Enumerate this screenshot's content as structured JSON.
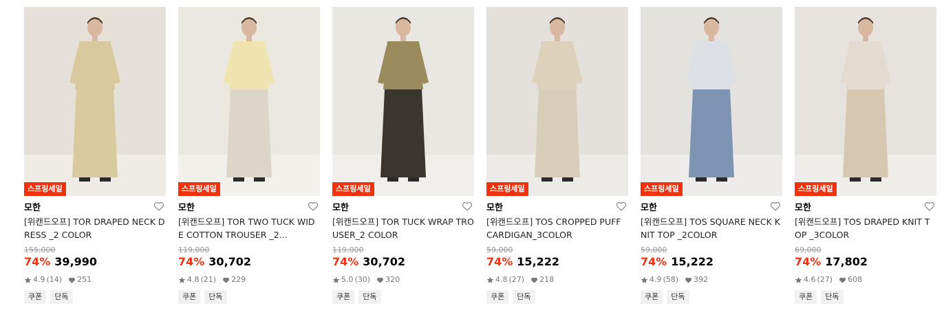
{
  "products": [
    {
      "badge": "스프링세일",
      "brand": "모한",
      "name": "[위캔드오프] TOR DRAPED NECK DRESS _2 COLOR",
      "original_price": "155,000",
      "discount": "74%",
      "price": "39,990",
      "rating": "4.9",
      "reviews": "(14)",
      "likes": "251",
      "tags": [
        "쿠폰",
        "단독"
      ],
      "outfit": {
        "top": "#d9c99e",
        "bottom": "#d9c99e",
        "bg": "#e6e1d8"
      }
    },
    {
      "badge": "스프링세일",
      "brand": "모한",
      "name": "[위캔드오프] TOR TWO TUCK WIDE COTTON TROUSER _2...",
      "original_price": "119,000",
      "discount": "74%",
      "price": "30,702",
      "rating": "4.8",
      "reviews": "(21)",
      "likes": "229",
      "tags": [
        "쿠폰",
        "단독"
      ],
      "outfit": {
        "top": "#efe3b0",
        "bottom": "#ddd6c8",
        "bg": "#ebe8e0"
      }
    },
    {
      "badge": "스프링세일",
      "brand": "모한",
      "name": "[위캔드오프] TOR TUCK WRAP TROUSER_2 COLOR",
      "original_price": "119,000",
      "discount": "74%",
      "price": "30,702",
      "rating": "5.0",
      "reviews": "(30)",
      "likes": "320",
      "tags": [
        "쿠폰",
        "단독"
      ],
      "outfit": {
        "top": "#9b8a5c",
        "bottom": "#3a352d",
        "bg": "#e9e7e2"
      }
    },
    {
      "badge": "스프링세일",
      "brand": "모한",
      "name": "[위캔드오프] TOS CROPPED PUFF CARDIGAN_3COLOR",
      "original_price": "59,000",
      "discount": "74%",
      "price": "15,222",
      "rating": "4.8",
      "reviews": "(27)",
      "likes": "218",
      "tags": [
        "쿠폰",
        "단독"
      ],
      "outfit": {
        "top": "#dfd2bd",
        "bottom": "#d8cdb9",
        "bg": "#e4e1dc"
      }
    },
    {
      "badge": "스프링세일",
      "brand": "모한",
      "name": "[위캔드오프] TOS SQUARE NECK KNIT TOP _2COLOR",
      "original_price": "59,000",
      "discount": "74%",
      "price": "15,222",
      "rating": "4.9",
      "reviews": "(58)",
      "likes": "392",
      "tags": [
        "쿠폰",
        "단독"
      ],
      "outfit": {
        "top": "#dde0e4",
        "bottom": "#7d95b3",
        "bg": "#e3e2df"
      }
    },
    {
      "badge": "스프링세일",
      "brand": "모한",
      "name": "[위캔드오프] TOS DRAPED KNIT TOP _3COLOR",
      "original_price": "69,000",
      "discount": "74%",
      "price": "17,802",
      "rating": "4.6",
      "reviews": "(27)",
      "likes": "608",
      "tags": [
        "쿠폰",
        "단독"
      ],
      "outfit": {
        "top": "#e3dbcf",
        "bottom": "#d6c8b0",
        "bg": "#e6e3de"
      }
    }
  ],
  "colors": {
    "accent": "#f0320f",
    "strike": "#9a9a9a",
    "tag_bg": "#f1f1f1"
  }
}
